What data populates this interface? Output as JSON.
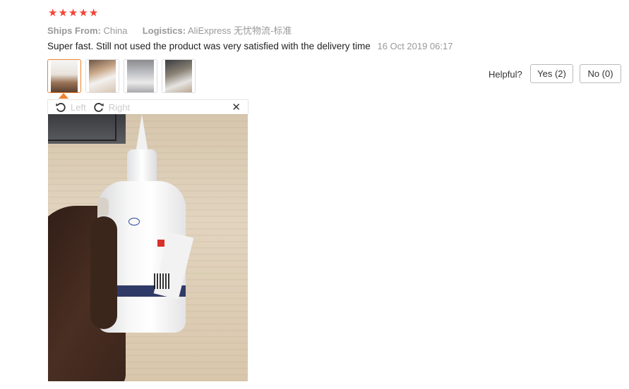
{
  "review": {
    "rating": 5,
    "stars": [
      "★",
      "★",
      "★",
      "★",
      "★"
    ],
    "ships_from_label": "Ships From:",
    "ships_from_value": "China",
    "logistics_label": "Logistics:",
    "logistics_value": "AliExpress 无忧物流-标准",
    "text": "Super fast. Still not used the product was very satisfied with the delivery time",
    "date": "16 Oct 2019 06:17"
  },
  "helpful": {
    "label": "Helpful?",
    "yes_label": "Yes (2)",
    "no_label": "No (0)"
  },
  "viewer": {
    "rotate_left_label": "Left",
    "rotate_right_label": "Right",
    "close_glyph": "✕",
    "selected_index": 0,
    "thumbnail_count": 4
  },
  "colors": {
    "star": "#f44336",
    "active_border": "#f0822b",
    "muted_text": "#999999"
  }
}
